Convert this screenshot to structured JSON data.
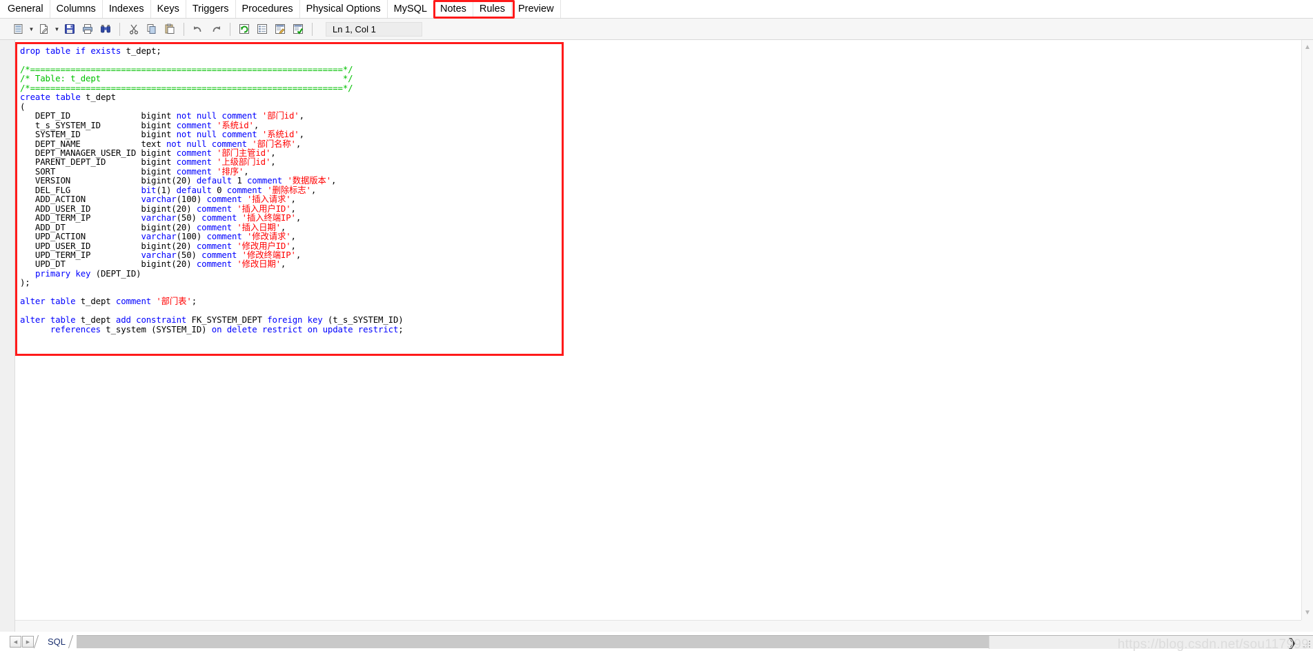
{
  "window": {
    "app_kind": "table-property-sheet"
  },
  "tabs": {
    "items": [
      {
        "label": "General",
        "name": "tab-general"
      },
      {
        "label": "Columns",
        "name": "tab-columns"
      },
      {
        "label": "Indexes",
        "name": "tab-indexes"
      },
      {
        "label": "Keys",
        "name": "tab-keys"
      },
      {
        "label": "Triggers",
        "name": "tab-triggers"
      },
      {
        "label": "Procedures",
        "name": "tab-procedures"
      },
      {
        "label": "Physical Options",
        "name": "tab-physical-options"
      },
      {
        "label": "MySQL",
        "name": "tab-mysql"
      },
      {
        "label": "Notes",
        "name": "tab-notes"
      },
      {
        "label": "Rules",
        "name": "tab-rules"
      },
      {
        "label": "Preview",
        "name": "tab-preview"
      }
    ],
    "active": "Preview",
    "highlight_color": "#ff1a1a"
  },
  "toolbar": {
    "buttons": [
      {
        "label": "Print Preview",
        "icon": "print-preview-icon",
        "has_dropdown": true
      },
      {
        "label": "Edit With",
        "icon": "edit-with-icon",
        "has_dropdown": true
      },
      {
        "label": "Save",
        "icon": "save-icon",
        "has_dropdown": false
      },
      {
        "label": "Print",
        "icon": "print-icon",
        "has_dropdown": false
      },
      {
        "label": "Find",
        "icon": "find-binoculars-icon",
        "has_dropdown": false
      },
      {
        "label": "Cut",
        "icon": "cut-scissors-icon",
        "has_dropdown": false
      },
      {
        "label": "Copy",
        "icon": "copy-icon",
        "has_dropdown": false
      },
      {
        "label": "Paste",
        "icon": "paste-icon",
        "has_dropdown": false
      },
      {
        "label": "Undo",
        "icon": "undo-arrow-icon",
        "has_dropdown": false
      },
      {
        "label": "Redo",
        "icon": "redo-arrow-icon",
        "has_dropdown": false
      },
      {
        "label": "Refresh",
        "icon": "refresh-icon",
        "has_dropdown": false
      },
      {
        "label": "Properties",
        "icon": "properties-list-icon",
        "has_dropdown": false
      },
      {
        "label": "Edit",
        "icon": "edit-pencil-icon",
        "has_dropdown": false
      },
      {
        "label": "Check Model",
        "icon": "check-model-icon",
        "has_dropdown": false
      }
    ],
    "cursor_position": "Ln 1, Col 1"
  },
  "editor": {
    "code_lines": [
      [
        {
          "t": "drop table if exists ",
          "c": "k"
        },
        {
          "t": "t_dept;",
          "c": "p"
        }
      ],
      [],
      [
        {
          "t": "/*==============================================================*/",
          "c": "c"
        }
      ],
      [
        {
          "t": "/* Table: t_dept                                                */",
          "c": "c"
        }
      ],
      [
        {
          "t": "/*==============================================================*/",
          "c": "c"
        }
      ],
      [
        {
          "t": "create table ",
          "c": "k"
        },
        {
          "t": "t_dept",
          "c": "p"
        }
      ],
      [
        {
          "t": "(",
          "c": "p"
        }
      ],
      [
        {
          "t": "   DEPT_ID              bigint ",
          "c": "p"
        },
        {
          "t": "not null comment ",
          "c": "k"
        },
        {
          "t": "'部门id'",
          "c": "s"
        },
        {
          "t": ",",
          "c": "p"
        }
      ],
      [
        {
          "t": "   t_s_SYSTEM_ID        bigint ",
          "c": "p"
        },
        {
          "t": "comment ",
          "c": "k"
        },
        {
          "t": "'系统id'",
          "c": "s"
        },
        {
          "t": ",",
          "c": "p"
        }
      ],
      [
        {
          "t": "   SYSTEM_ID            bigint ",
          "c": "p"
        },
        {
          "t": "not null comment ",
          "c": "k"
        },
        {
          "t": "'系统id'",
          "c": "s"
        },
        {
          "t": ",",
          "c": "p"
        }
      ],
      [
        {
          "t": "   DEPT_NAME            text ",
          "c": "p"
        },
        {
          "t": "not null comment ",
          "c": "k"
        },
        {
          "t": "'部门名称'",
          "c": "s"
        },
        {
          "t": ",",
          "c": "p"
        }
      ],
      [
        {
          "t": "   DEPT_MANAGER_USER_ID bigint ",
          "c": "p"
        },
        {
          "t": "comment ",
          "c": "k"
        },
        {
          "t": "'部门主管id'",
          "c": "s"
        },
        {
          "t": ",",
          "c": "p"
        }
      ],
      [
        {
          "t": "   PARENT_DEPT_ID       bigint ",
          "c": "p"
        },
        {
          "t": "comment ",
          "c": "k"
        },
        {
          "t": "'上级部门id'",
          "c": "s"
        },
        {
          "t": ",",
          "c": "p"
        }
      ],
      [
        {
          "t": "   SORT                 bigint ",
          "c": "p"
        },
        {
          "t": "comment ",
          "c": "k"
        },
        {
          "t": "'排序'",
          "c": "s"
        },
        {
          "t": ",",
          "c": "p"
        }
      ],
      [
        {
          "t": "   VERSION              bigint(20) ",
          "c": "p"
        },
        {
          "t": "default ",
          "c": "k"
        },
        {
          "t": "1 ",
          "c": "p"
        },
        {
          "t": "comment ",
          "c": "k"
        },
        {
          "t": "'数据版本'",
          "c": "s"
        },
        {
          "t": ",",
          "c": "p"
        }
      ],
      [
        {
          "t": "   DEL_FLG              ",
          "c": "p"
        },
        {
          "t": "bit",
          "c": "k"
        },
        {
          "t": "(1) ",
          "c": "p"
        },
        {
          "t": "default ",
          "c": "k"
        },
        {
          "t": "0 ",
          "c": "p"
        },
        {
          "t": "comment ",
          "c": "k"
        },
        {
          "t": "'删除标志'",
          "c": "s"
        },
        {
          "t": ",",
          "c": "p"
        }
      ],
      [
        {
          "t": "   ADD_ACTION           ",
          "c": "p"
        },
        {
          "t": "varchar",
          "c": "k"
        },
        {
          "t": "(100) ",
          "c": "p"
        },
        {
          "t": "comment ",
          "c": "k"
        },
        {
          "t": "'插入请求'",
          "c": "s"
        },
        {
          "t": ",",
          "c": "p"
        }
      ],
      [
        {
          "t": "   ADD_USER_ID          bigint(20) ",
          "c": "p"
        },
        {
          "t": "comment ",
          "c": "k"
        },
        {
          "t": "'插入用户ID'",
          "c": "s"
        },
        {
          "t": ",",
          "c": "p"
        }
      ],
      [
        {
          "t": "   ADD_TERM_IP          ",
          "c": "p"
        },
        {
          "t": "varchar",
          "c": "k"
        },
        {
          "t": "(50) ",
          "c": "p"
        },
        {
          "t": "comment ",
          "c": "k"
        },
        {
          "t": "'插入终端IP'",
          "c": "s"
        },
        {
          "t": ",",
          "c": "p"
        }
      ],
      [
        {
          "t": "   ADD_DT               bigint(20) ",
          "c": "p"
        },
        {
          "t": "comment ",
          "c": "k"
        },
        {
          "t": "'插入日期'",
          "c": "s"
        },
        {
          "t": ",",
          "c": "p"
        }
      ],
      [
        {
          "t": "   UPD_ACTION           ",
          "c": "p"
        },
        {
          "t": "varchar",
          "c": "k"
        },
        {
          "t": "(100) ",
          "c": "p"
        },
        {
          "t": "comment ",
          "c": "k"
        },
        {
          "t": "'修改请求'",
          "c": "s"
        },
        {
          "t": ",",
          "c": "p"
        }
      ],
      [
        {
          "t": "   UPD_USER_ID          bigint(20) ",
          "c": "p"
        },
        {
          "t": "comment ",
          "c": "k"
        },
        {
          "t": "'修改用户ID'",
          "c": "s"
        },
        {
          "t": ",",
          "c": "p"
        }
      ],
      [
        {
          "t": "   UPD_TERM_IP          ",
          "c": "p"
        },
        {
          "t": "varchar",
          "c": "k"
        },
        {
          "t": "(50) ",
          "c": "p"
        },
        {
          "t": "comment ",
          "c": "k"
        },
        {
          "t": "'修改终端IP'",
          "c": "s"
        },
        {
          "t": ",",
          "c": "p"
        }
      ],
      [
        {
          "t": "   UPD_DT               bigint(20) ",
          "c": "p"
        },
        {
          "t": "comment ",
          "c": "k"
        },
        {
          "t": "'修改日期'",
          "c": "s"
        },
        {
          "t": ",",
          "c": "p"
        }
      ],
      [
        {
          "t": "   ",
          "c": "p"
        },
        {
          "t": "primary key ",
          "c": "k"
        },
        {
          "t": "(DEPT_ID)",
          "c": "p"
        }
      ],
      [
        {
          "t": ");",
          "c": "p"
        }
      ],
      [],
      [
        {
          "t": "alter table ",
          "c": "k"
        },
        {
          "t": "t_dept ",
          "c": "p"
        },
        {
          "t": "comment ",
          "c": "k"
        },
        {
          "t": "'部门表'",
          "c": "s"
        },
        {
          "t": ";",
          "c": "p"
        }
      ],
      [],
      [
        {
          "t": "alter table ",
          "c": "k"
        },
        {
          "t": "t_dept ",
          "c": "p"
        },
        {
          "t": "add constraint ",
          "c": "k"
        },
        {
          "t": "FK_SYSTEM_DEPT ",
          "c": "p"
        },
        {
          "t": "foreign key ",
          "c": "k"
        },
        {
          "t": "(t_s_SYSTEM_ID)",
          "c": "p"
        }
      ],
      [
        {
          "t": "      ",
          "c": "p"
        },
        {
          "t": "references ",
          "c": "k"
        },
        {
          "t": "t_system (SYSTEM_ID) ",
          "c": "p"
        },
        {
          "t": "on delete restrict on update restrict",
          "c": "k"
        },
        {
          "t": ";",
          "c": "p"
        }
      ]
    ],
    "highlight_color": "#ff1a1a",
    "keyword_color": "#0000ff",
    "string_color": "#ff0000",
    "comment_color": "#00c000"
  },
  "bottom": {
    "nav_prev": "◀",
    "nav_next": "▶",
    "sheet_tab_label": "SQL",
    "scroll_right_chevron": "❯"
  },
  "watermark": {
    "text": "https://blog.csdn.net/sou117999"
  }
}
